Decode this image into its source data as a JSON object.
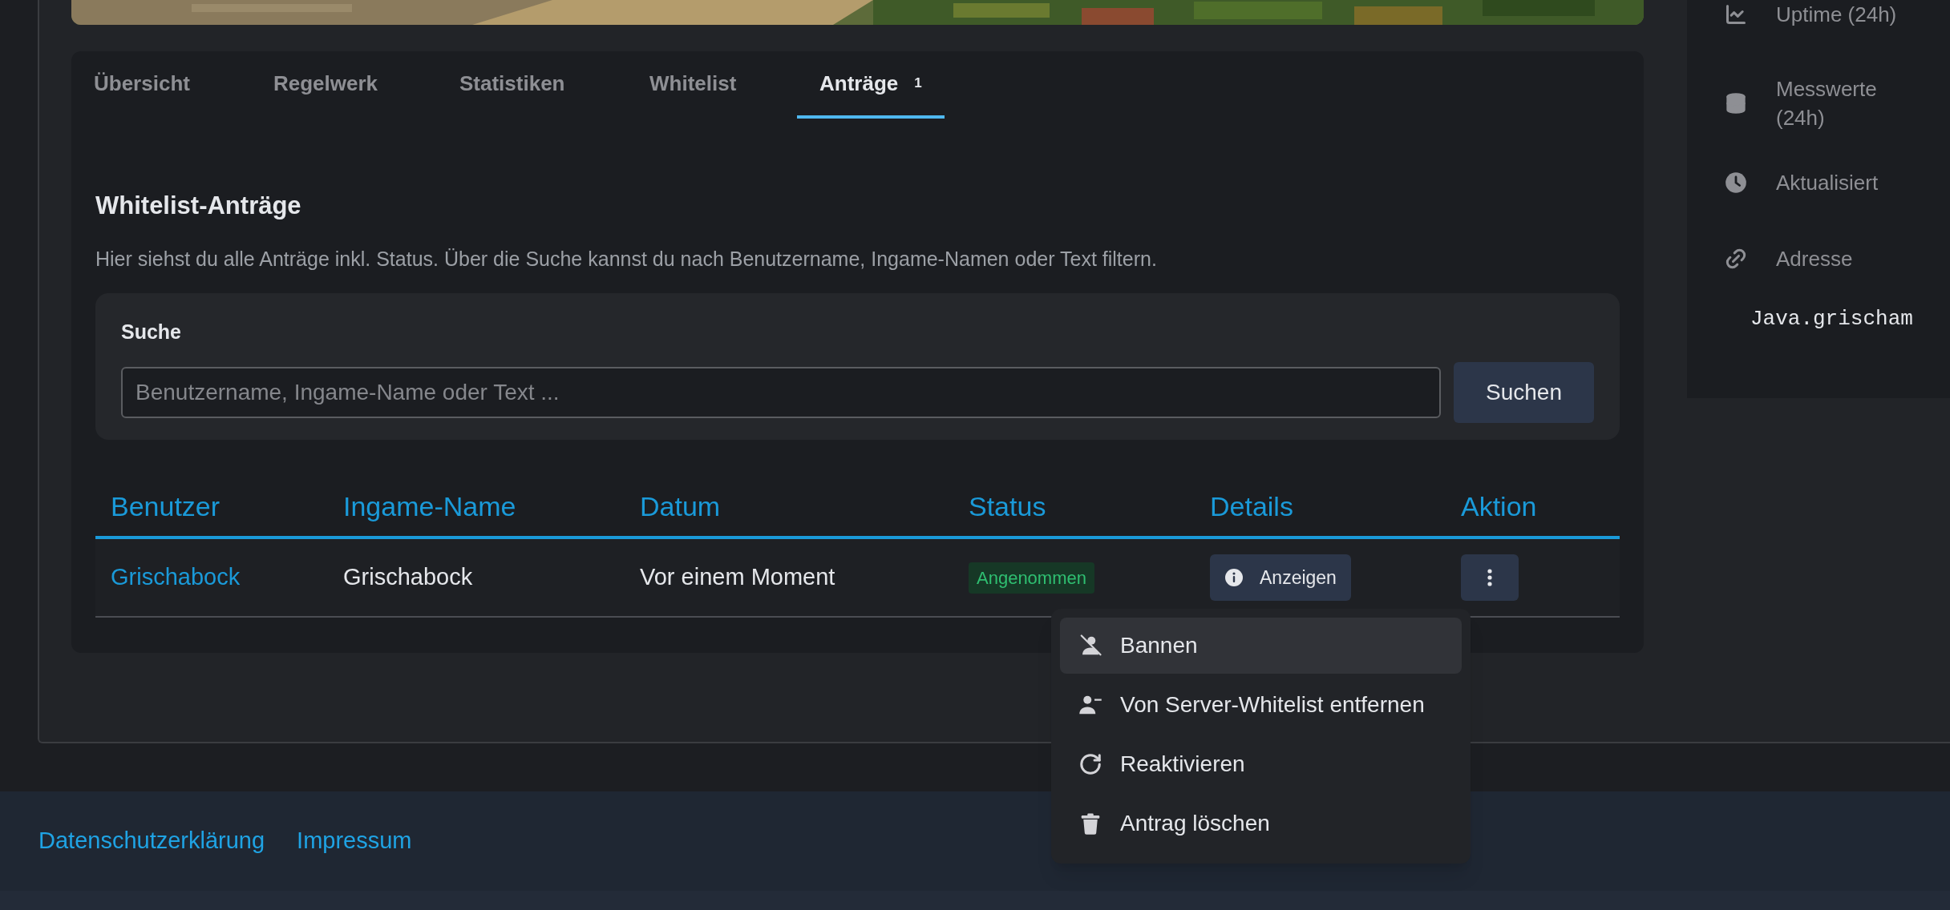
{
  "tabs": [
    {
      "label": "Übersicht",
      "selected": false
    },
    {
      "label": "Regelwerk",
      "selected": false
    },
    {
      "label": "Statistiken",
      "selected": false
    },
    {
      "label": "Whitelist",
      "selected": false
    },
    {
      "label": "Anträge",
      "badge": "1",
      "selected": true
    }
  ],
  "section": {
    "title": "Whitelist-Anträge",
    "description": "Hier siehst du alle Anträge inkl. Status. Über die Suche kannst du nach Benutzername, Ingame-Namen oder Text filtern."
  },
  "search": {
    "label": "Suche",
    "placeholder": "Benutzername, Ingame-Name oder Text ...",
    "button": "Suchen"
  },
  "table": {
    "columns": [
      "Benutzer",
      "Ingame-Name",
      "Datum",
      "Status",
      "Details",
      "Aktion"
    ],
    "rows": [
      {
        "user": "Grischabock",
        "ingame_name": "Grischabock",
        "date": "Vor einem Moment",
        "status": "Angenommen",
        "details_button": "Anzeigen"
      }
    ]
  },
  "action_menu": {
    "items": [
      {
        "label": "Bannen",
        "selected": true
      },
      {
        "label": "Von Server-Whitelist entfernen",
        "selected": false
      },
      {
        "label": "Reaktivieren",
        "selected": false
      },
      {
        "label": "Antrag löschen",
        "selected": false
      }
    ]
  },
  "sidebar": {
    "items": [
      {
        "label": "Uptime (24h)"
      },
      {
        "label": "Messwerte (24h)"
      },
      {
        "label": "Aktualisiert"
      },
      {
        "label": "Adresse",
        "value": "Java.grischam"
      }
    ]
  },
  "footer": {
    "links": [
      "Datenschutzerklärung",
      "Impressum"
    ]
  }
}
